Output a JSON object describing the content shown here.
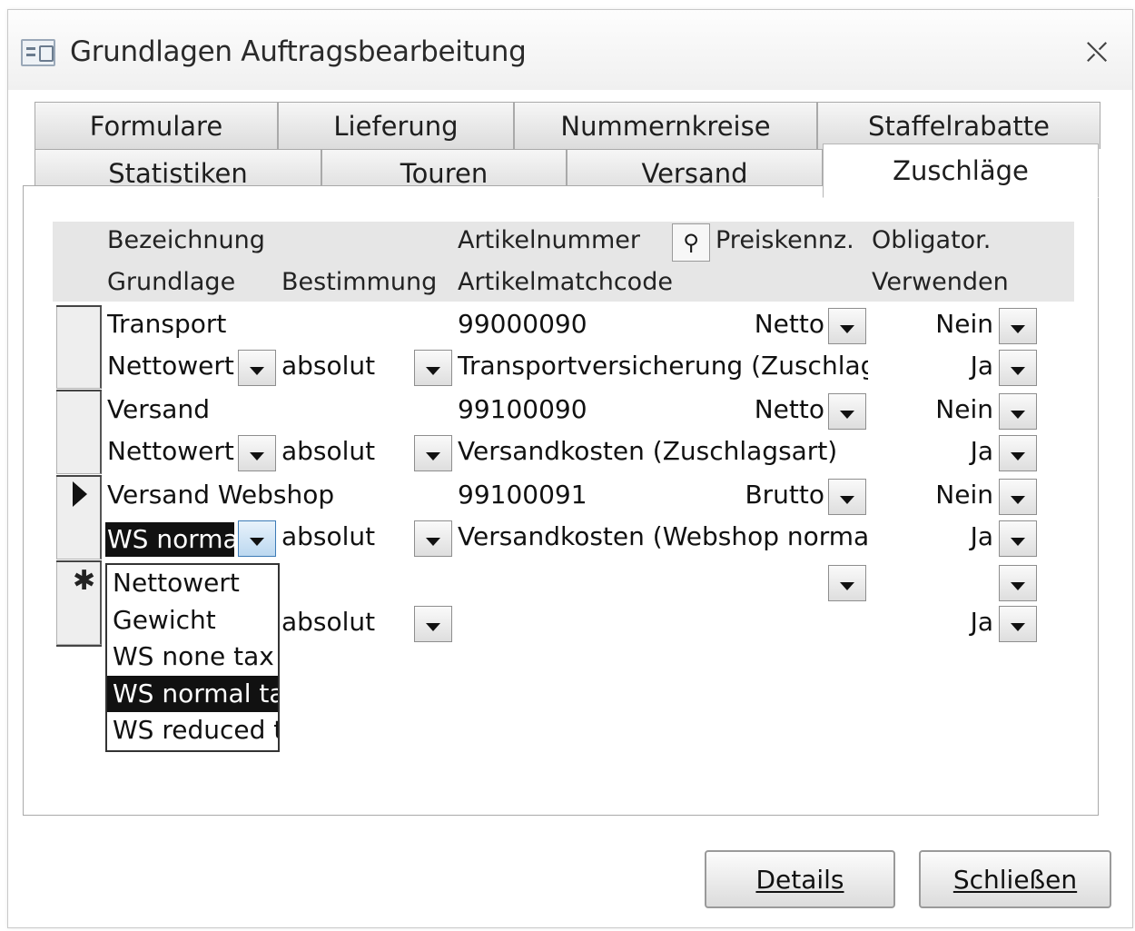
{
  "window": {
    "title": "Grundlagen Auftragsbearbeitung"
  },
  "tabs": {
    "row1": [
      "Formulare",
      "Lieferung",
      "Nummernkreise",
      "Staffelrabatte"
    ],
    "row2": [
      "Statistiken",
      "Touren",
      "Versand",
      "Zuschläge"
    ],
    "active": "Zuschläge"
  },
  "headers": {
    "bezeichnung": "Bezeichnung",
    "artikelnummer": "Artikelnummer",
    "preiskennz": "Preiskennz.",
    "obligator": "Obligator.",
    "grundlage": "Grundlage",
    "bestimmung": "Bestimmung",
    "artikelmatchcode": "Artikelmatchcode",
    "verwenden": "Verwenden"
  },
  "records": [
    {
      "bezeichnung": "Transport",
      "artikelnummer": "99000090",
      "preiskennz": "Netto",
      "obligator": "Nein",
      "grundlage": "Nettowert",
      "bestimmung": "absolut",
      "artikelmatchcode": "Transportversicherung (Zuschlagsa",
      "verwenden": "Ja"
    },
    {
      "bezeichnung": "Versand",
      "artikelnummer": "99100090",
      "preiskennz": "Netto",
      "obligator": "Nein",
      "grundlage": "Nettowert",
      "bestimmung": "absolut",
      "artikelmatchcode": "Versandkosten (Zuschlagsart)",
      "verwenden": "Ja"
    },
    {
      "bezeichnung": "Versand Webshop",
      "artikelnummer": "99100091",
      "preiskennz": "Brutto",
      "obligator": "Nein",
      "grundlage": "WS normal",
      "bestimmung": "absolut",
      "artikelmatchcode": "Versandkosten (Webshop normaler",
      "verwenden": "Ja"
    }
  ],
  "new_record": {
    "bestimmung": "absolut",
    "verwenden": "Ja",
    "marker": "✱"
  },
  "dropdown_options": [
    "Nettowert",
    "Gewicht",
    "WS none tax",
    "WS normal tax",
    "WS reduced ta"
  ],
  "dropdown_highlighted_index": 3,
  "buttons": {
    "details": "Details",
    "schliessen": "Schließen"
  }
}
